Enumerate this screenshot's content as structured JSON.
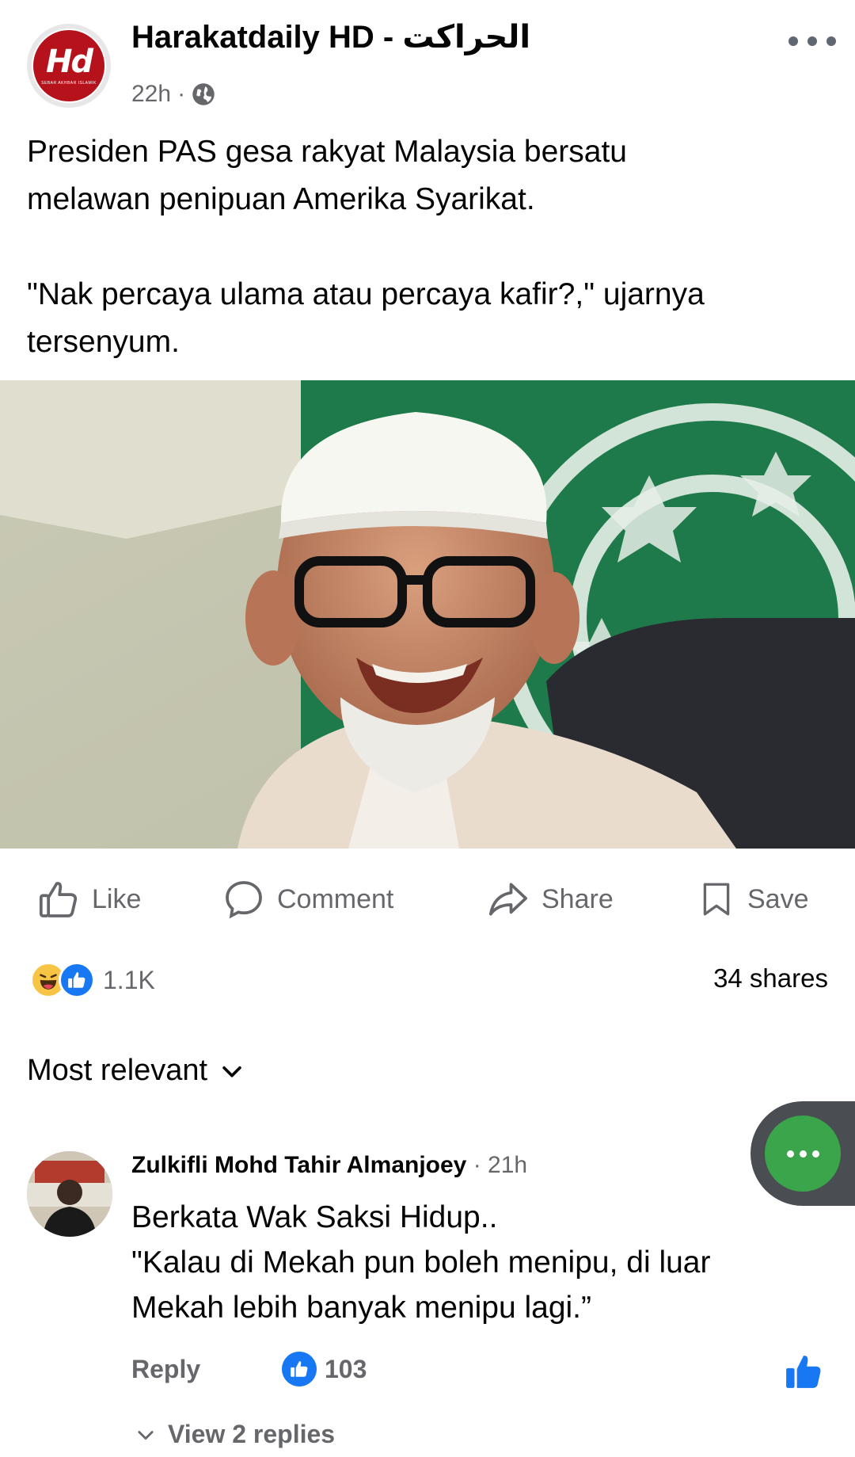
{
  "post": {
    "page_name": "Harakatdaily HD - الحراكت",
    "logo_text": "Hd",
    "logo_sub": "SEBAR AKHBAR ISLAMIK",
    "time": "22h",
    "separator": "·",
    "privacy_icon": "globe-icon",
    "text_p1": "Presiden PAS gesa rakyat Malaysia bersatu\nmelawan penipuan Amerika Syarikat.",
    "text_p2": "\"Nak percaya ulama atau percaya kafir?,\" ujarnya\ntersenyum."
  },
  "actions": {
    "like": "Like",
    "comment": "Comment",
    "share": "Share",
    "save": "Save"
  },
  "stats": {
    "reactions_count": "1.1K",
    "reaction_icons": [
      "haha-icon",
      "like-icon"
    ],
    "shares": "34 shares"
  },
  "comments_sort": "Most relevant",
  "comment": {
    "author": "Zulkifli Mohd Tahir Almanjoey",
    "time": "· 21h",
    "body": "Berkata Wak Saksi Hidup..\n\"Kalau di Mekah pun boleh menipu, di luar\nMekah lebih banyak menipu lagi.”",
    "reply_label": "Reply",
    "likes": "103",
    "view_replies": "View 2 replies"
  },
  "colors": {
    "brand_red": "#b5121b",
    "facebook_blue": "#1877f2",
    "fab_green": "#3aa54a",
    "muted_text": "#65676b"
  }
}
